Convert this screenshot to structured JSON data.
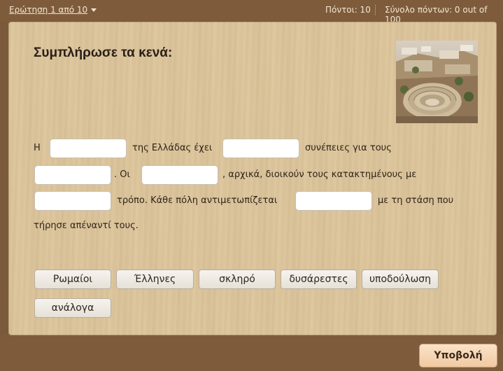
{
  "topbar": {
    "question_nav": "Ερώτηση 1 από 10",
    "points_label": "Πόντοι: 10",
    "total_label": "Σύνολο πόντων: 0 out of 100"
  },
  "question": {
    "title": "Συμπλήρωσε τα κενά:",
    "image_alt": "ancient-theater-photo",
    "lines": [
      {
        "parts": [
          {
            "type": "text",
            "value": "Η"
          },
          {
            "type": "blank"
          },
          {
            "type": "text",
            "value": "της Ελλάδας έχει"
          },
          {
            "type": "blank"
          },
          {
            "type": "text",
            "value": "συνέπειες για τους"
          }
        ]
      },
      {
        "parts": [
          {
            "type": "blank"
          },
          {
            "type": "text",
            "value": ". Οι"
          },
          {
            "type": "blank"
          },
          {
            "type": "text",
            "value": ", αρχικά, διοικούν τους κατακτημένους με"
          }
        ]
      },
      {
        "parts": [
          {
            "type": "blank"
          },
          {
            "type": "text",
            "value": "τρόπο. Κάθε πόλη αντιμετωπίζεται"
          },
          {
            "type": "blank"
          },
          {
            "type": "text",
            "value": "με τη στάση που"
          }
        ]
      },
      {
        "parts": [
          {
            "type": "text",
            "value": "τήρησε απέναντί τους."
          }
        ]
      }
    ]
  },
  "choices": [
    "Ρωμαίοι",
    "Έλληνες",
    "σκληρό",
    "δυσάρεστες",
    "υποδούλωση",
    "ανάλογα"
  ],
  "footer": {
    "submit_label": "Υποβολή"
  }
}
